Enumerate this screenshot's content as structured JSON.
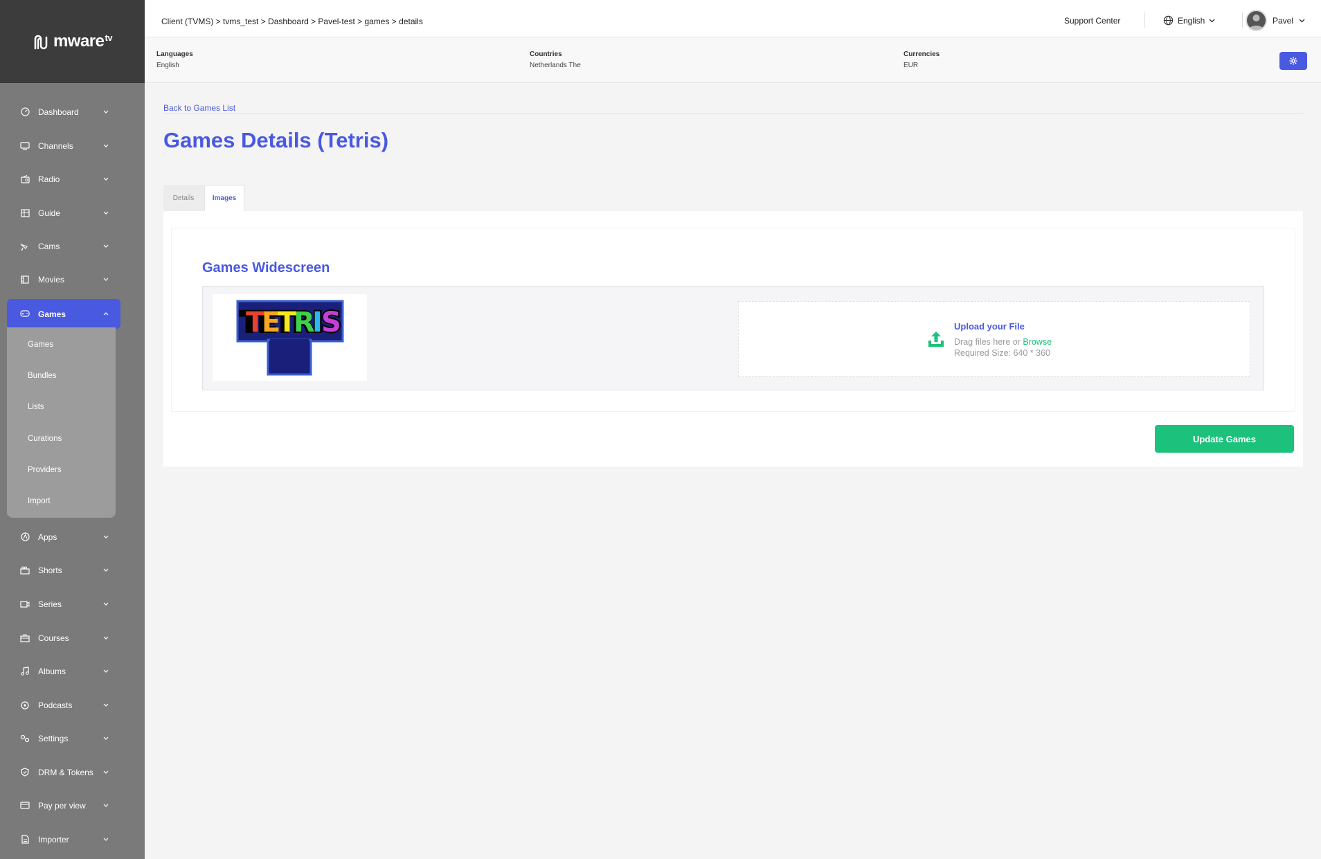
{
  "app": {
    "brand": "mware",
    "brand_suffix": "tv"
  },
  "sidebar": {
    "items": [
      {
        "label": "Dashboard",
        "icon": "dashboard-icon"
      },
      {
        "label": "Channels",
        "icon": "monitor-icon"
      },
      {
        "label": "Radio",
        "icon": "radio-icon"
      },
      {
        "label": "Guide",
        "icon": "guide-icon"
      },
      {
        "label": "Cams",
        "icon": "camera-icon"
      },
      {
        "label": "Movies",
        "icon": "film-icon"
      },
      {
        "label": "Games",
        "icon": "gamepad-icon",
        "active": true
      },
      {
        "label": "Apps",
        "icon": "apps-icon"
      },
      {
        "label": "Shorts",
        "icon": "shorts-icon"
      },
      {
        "label": "Series",
        "icon": "video-icon"
      },
      {
        "label": "Courses",
        "icon": "courses-icon"
      },
      {
        "label": "Albums",
        "icon": "music-icon"
      },
      {
        "label": "Podcasts",
        "icon": "podcast-icon"
      },
      {
        "label": "Settings",
        "icon": "settings-icon"
      },
      {
        "label": "DRM & Tokens",
        "icon": "shield-icon"
      },
      {
        "label": "Pay per view",
        "icon": "card-icon"
      },
      {
        "label": "Importer",
        "icon": "file-icon"
      }
    ],
    "submenu": [
      "Games",
      "Bundles",
      "Lists",
      "Curations",
      "Providers",
      "Import"
    ]
  },
  "topbar": {
    "breadcrumb": "Client (TVMS)  > tvms_test  > Dashboard  > Pavel-test > games > details",
    "support": "Support Center",
    "language": "English",
    "user": "Pavel"
  },
  "infobar": {
    "languages_label": "Languages",
    "languages_value": "English",
    "countries_label": "Countries",
    "countries_value": "Netherlands The",
    "currencies_label": "Currencies",
    "currencies_value": "EUR"
  },
  "main": {
    "back_link": "Back to Games List",
    "title": "Games Details (Tetris)",
    "tabs": [
      {
        "label": "Details",
        "active": false
      },
      {
        "label": "Images",
        "active": true
      }
    ],
    "section_title": "Games Widescreen",
    "image_alt": "TETRIS",
    "upload": {
      "title": "Upload your File",
      "drag_text": "Drag files here or ",
      "browse": "Browse",
      "required": "Required Size: 640 * 360"
    },
    "update_button": "Update Games"
  },
  "colors": {
    "accent": "#4959e0",
    "success": "#1cc27c",
    "sidebar_bg": "#7a7a7a",
    "logo_bg": "#3c3c3c"
  }
}
